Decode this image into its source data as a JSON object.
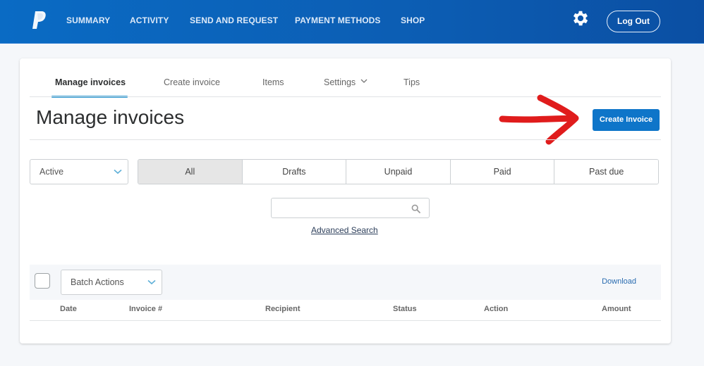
{
  "header": {
    "logo": "paypal-logo",
    "nav": [
      "SUMMARY",
      "ACTIVITY",
      "SEND AND REQUEST",
      "PAYMENT METHODS",
      "SHOP"
    ],
    "settings_icon": "gear-icon",
    "logout_label": "Log Out",
    "brand_color": "#0c5db3"
  },
  "tabs": [
    {
      "label": "Manage invoices",
      "active": true
    },
    {
      "label": "Create invoice",
      "active": false
    },
    {
      "label": "Items",
      "active": false
    },
    {
      "label": "Settings",
      "active": false,
      "has_dropdown": true
    },
    {
      "label": "Tips",
      "active": false
    }
  ],
  "page": {
    "title": "Manage invoices",
    "create_button": "Create Invoice",
    "accent_color": "#0e75c9",
    "annotation": "red-arrow"
  },
  "filters": {
    "status_select": "Active",
    "segments": [
      "All",
      "Drafts",
      "Unpaid",
      "Paid",
      "Past due"
    ],
    "selected_segment": "All"
  },
  "search": {
    "value": "",
    "placeholder": "",
    "advanced_label": "Advanced Search"
  },
  "table": {
    "batch_actions": "Batch Actions",
    "download_label": "Download",
    "columns": [
      "Date",
      "Invoice #",
      "Recipient",
      "Status",
      "Action",
      "Amount"
    ],
    "rows": []
  }
}
